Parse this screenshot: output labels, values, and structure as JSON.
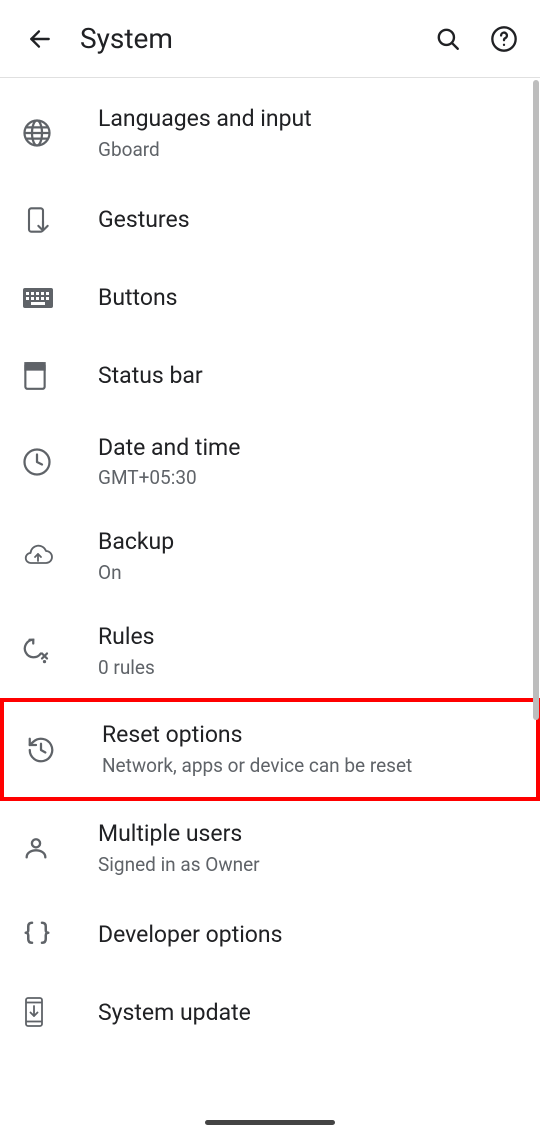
{
  "header": {
    "title": "System"
  },
  "items": [
    {
      "title": "Languages and input",
      "subtitle": "Gboard"
    },
    {
      "title": "Gestures",
      "subtitle": ""
    },
    {
      "title": "Buttons",
      "subtitle": ""
    },
    {
      "title": "Status bar",
      "subtitle": ""
    },
    {
      "title": "Date and time",
      "subtitle": "GMT+05:30"
    },
    {
      "title": "Backup",
      "subtitle": "On"
    },
    {
      "title": "Rules",
      "subtitle": "0 rules"
    },
    {
      "title": "Reset options",
      "subtitle": "Network, apps or device can be reset"
    },
    {
      "title": "Multiple users",
      "subtitle": "Signed in as Owner"
    },
    {
      "title": "Developer options",
      "subtitle": ""
    },
    {
      "title": "System update",
      "subtitle": ""
    }
  ],
  "highlighted_index": 7
}
